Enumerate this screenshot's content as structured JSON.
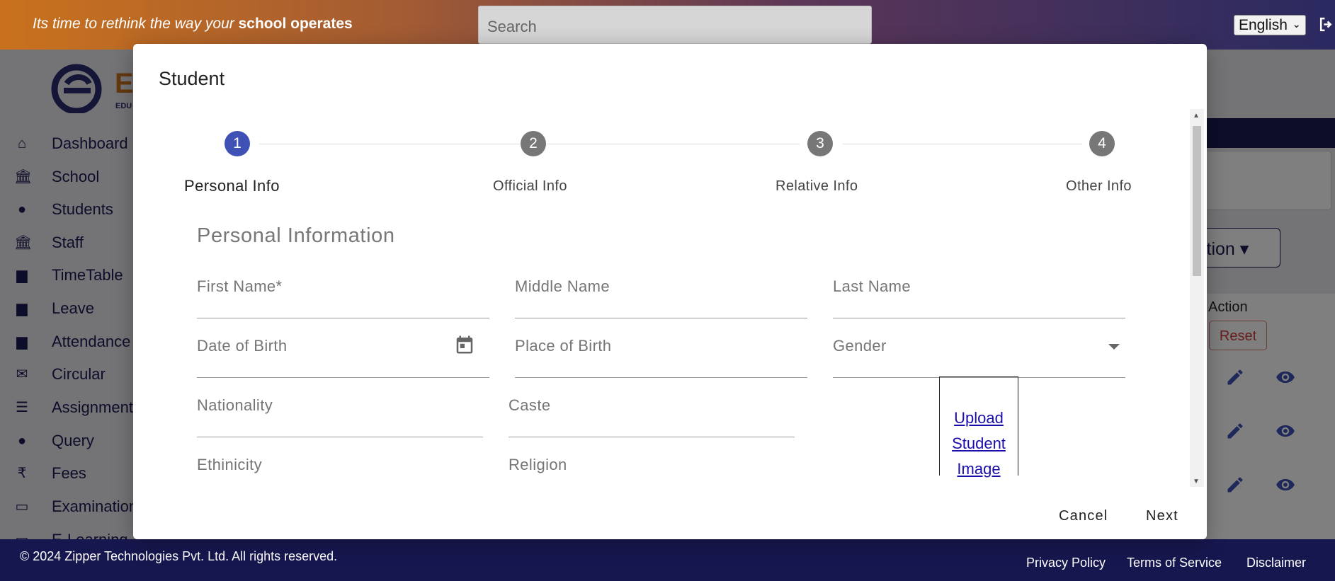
{
  "topbar": {
    "tagline_prefix": "Its time to rethink the way your ",
    "tagline_bold": "school operates",
    "search_placeholder": "Search",
    "language": "English"
  },
  "logo": {
    "letter": "E",
    "sub": "EDU"
  },
  "sidebar": {
    "items": [
      {
        "label": "Dashboard",
        "icon": "home-icon"
      },
      {
        "label": "School",
        "icon": "bank-icon"
      },
      {
        "label": "Students",
        "icon": "circle-icon"
      },
      {
        "label": "Staff",
        "icon": "bank-icon"
      },
      {
        "label": "TimeTable",
        "icon": "calendar-icon"
      },
      {
        "label": "Leave",
        "icon": "calendar-icon"
      },
      {
        "label": "Attendance",
        "icon": "calendar-icon"
      },
      {
        "label": "Circular",
        "icon": "mail-icon"
      },
      {
        "label": "Assignment",
        "icon": "checklist-icon"
      },
      {
        "label": "Query",
        "icon": "chat-icon"
      },
      {
        "label": "Fees",
        "icon": "rupee-icon"
      },
      {
        "label": "Examination",
        "icon": "monitor-icon"
      },
      {
        "label": "E-Learning",
        "icon": "laptop-icon"
      }
    ]
  },
  "background": {
    "action_button": "ction",
    "table_action_header": "Action",
    "reset_button": "Reset"
  },
  "modal": {
    "title": "Student",
    "steps": [
      {
        "number": "1",
        "label": "Personal Info",
        "active": true
      },
      {
        "number": "2",
        "label": "Official Info",
        "active": false
      },
      {
        "number": "3",
        "label": "Relative Info",
        "active": false
      },
      {
        "number": "4",
        "label": "Other Info",
        "active": false
      }
    ],
    "section_title": "Personal Information",
    "fields": {
      "first_name": "First Name*",
      "middle_name": "Middle Name",
      "last_name": "Last Name",
      "dob": "Date of Birth",
      "place_of_birth": "Place of Birth",
      "gender": "Gender",
      "nationality": "Nationality",
      "caste": "Caste",
      "ethnicity": "Ethinicity",
      "religion": "Religion"
    },
    "upload": [
      "Upload",
      "Student",
      "Image"
    ],
    "cancel": "Cancel",
    "next": "Next"
  },
  "footer": {
    "copyright": "© 2024 Zipper Technologies Pvt. Ltd. All rights reserved.",
    "links": [
      "Privacy Policy",
      "Terms of Service",
      "Disclaimer"
    ]
  },
  "colors": {
    "primary": "#3f51b5",
    "navy": "#171750",
    "orange": "#c9711d"
  }
}
